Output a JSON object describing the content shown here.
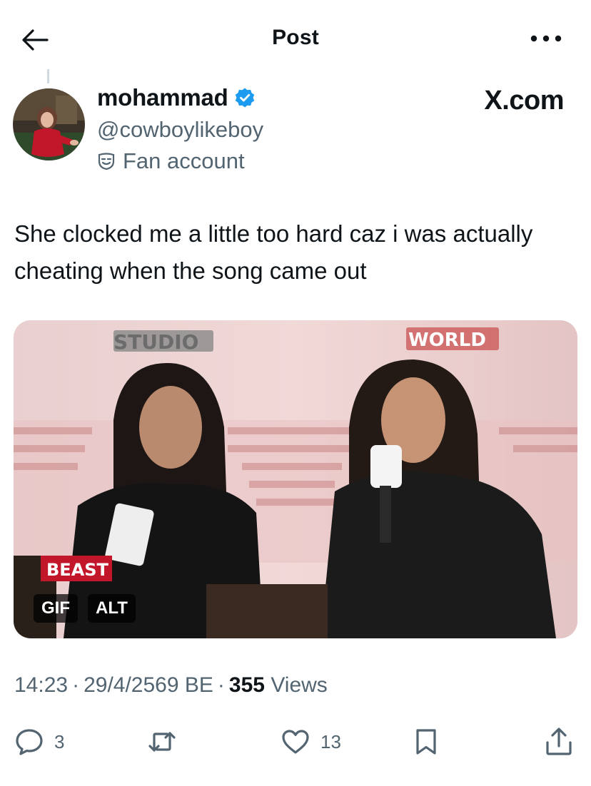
{
  "header": {
    "title": "Post",
    "back_icon": "arrow-left-icon",
    "more_icon": "more-horizontal-icon"
  },
  "author": {
    "display_name": "mohammad",
    "handle": "@cowboylikeboy",
    "label": "Fan account",
    "verified": true,
    "verified_color": "#1d9bf0"
  },
  "brand": {
    "text": "X.com"
  },
  "post": {
    "text": "She clocked me a little too hard caz i was actually cheating when the song came out"
  },
  "media": {
    "type": "gif",
    "gif_label": "GIF",
    "alt_label": "ALT",
    "overlay_studio": "STUDIO",
    "overlay_world": "WORLD",
    "overlay_beast": "BEAST"
  },
  "meta": {
    "time": "14:23",
    "separator": "·",
    "date": "29/4/2569 BE",
    "views_count": "355",
    "views_label": "Views"
  },
  "actions": {
    "reply_count": "3",
    "repost_count": "",
    "like_count": "13"
  },
  "colors": {
    "text_primary": "#0f1419",
    "text_secondary": "#536471",
    "accent": "#1d9bf0"
  }
}
